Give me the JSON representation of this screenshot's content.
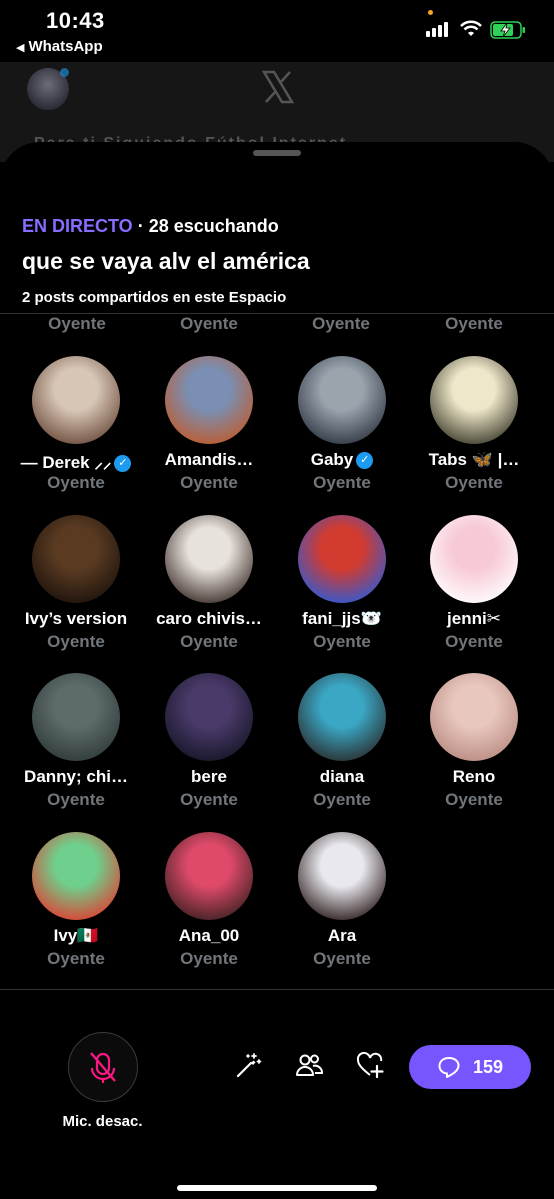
{
  "status_bar": {
    "time": "10:43",
    "back_app": "WhatsApp"
  },
  "background": {
    "tabs_text": "Para ti    Siguiendo    Fútbol    Internet"
  },
  "space": {
    "live_label": "EN DIRECTO",
    "listening": "· 28 escuchando",
    "title": "que se vaya alv el américa",
    "shared_posts": "2 posts compartidos en este Espacio"
  },
  "previous_row_roles": [
    "Oyente",
    "Oyente",
    "Oyente",
    "Oyente"
  ],
  "participants": [
    {
      "name": "— Derek ⸝⸝",
      "verified": true,
      "role": "Oyente",
      "avatar_colors": [
        "#d7c6b6",
        "#6b4a3a"
      ]
    },
    {
      "name": "Amandis…",
      "verified": false,
      "role": "Oyente",
      "avatar_colors": [
        "#7a8fb3",
        "#c05a2a"
      ]
    },
    {
      "name": "Gaby",
      "verified": true,
      "role": "Oyente",
      "avatar_colors": [
        "#9aa4ad",
        "#2c3440"
      ]
    },
    {
      "name": "Tabs 🦋 |…",
      "verified": false,
      "role": "Oyente",
      "avatar_colors": [
        "#efe7c9",
        "#3a3a2a"
      ]
    },
    {
      "name": "Ivy’s version",
      "verified": false,
      "role": "Oyente",
      "avatar_colors": [
        "#5a3b22",
        "#1c120c"
      ]
    },
    {
      "name": "caro chivis…",
      "verified": false,
      "role": "Oyente",
      "avatar_colors": [
        "#e8e2dc",
        "#3b2d28"
      ]
    },
    {
      "name": "fani_jjs🐻‍❄️",
      "verified": false,
      "role": "Oyente",
      "avatar_colors": [
        "#d23b2f",
        "#2a5bd8"
      ]
    },
    {
      "name": "jenni✂︎",
      "verified": false,
      "role": "Oyente",
      "avatar_colors": [
        "#f7c9d6",
        "#ffffff"
      ]
    },
    {
      "name": "Danny; chi…",
      "verified": false,
      "role": "Oyente",
      "avatar_colors": [
        "#5d6b6b",
        "#2e3a38"
      ]
    },
    {
      "name": "bere",
      "verified": false,
      "role": "Oyente",
      "avatar_colors": [
        "#4a3a6a",
        "#151525"
      ]
    },
    {
      "name": "diana",
      "verified": false,
      "role": "Oyente",
      "avatar_colors": [
        "#3aa7c5",
        "#2a2a2a"
      ]
    },
    {
      "name": "Reno",
      "verified": false,
      "role": "Oyente",
      "avatar_colors": [
        "#e8c7bf",
        "#b88a80"
      ]
    },
    {
      "name": "Ivy🇲🇽",
      "verified": false,
      "role": "Oyente",
      "avatar_colors": [
        "#6fcf8c",
        "#e23b2f"
      ]
    },
    {
      "name": "Ana_00",
      "verified": false,
      "role": "Oyente",
      "avatar_colors": [
        "#e04a6a",
        "#3a2020"
      ]
    },
    {
      "name": "Ara",
      "verified": false,
      "role": "Oyente",
      "avatar_colors": [
        "#e8e8ee",
        "#2a1a1a"
      ]
    }
  ],
  "bottom_bar": {
    "mic_label": "Mic. desac.",
    "reply_count": "159",
    "icons": [
      "mic-off-icon",
      "magic-wand-icon",
      "people-icon",
      "heart-plus-icon",
      "reply-icon"
    ],
    "accent": "#7856ff",
    "mic_off_color": "#f91880"
  },
  "colors": {
    "live": "#8a6bff",
    "verified": "#1d9bf0",
    "role": "#71767b"
  }
}
